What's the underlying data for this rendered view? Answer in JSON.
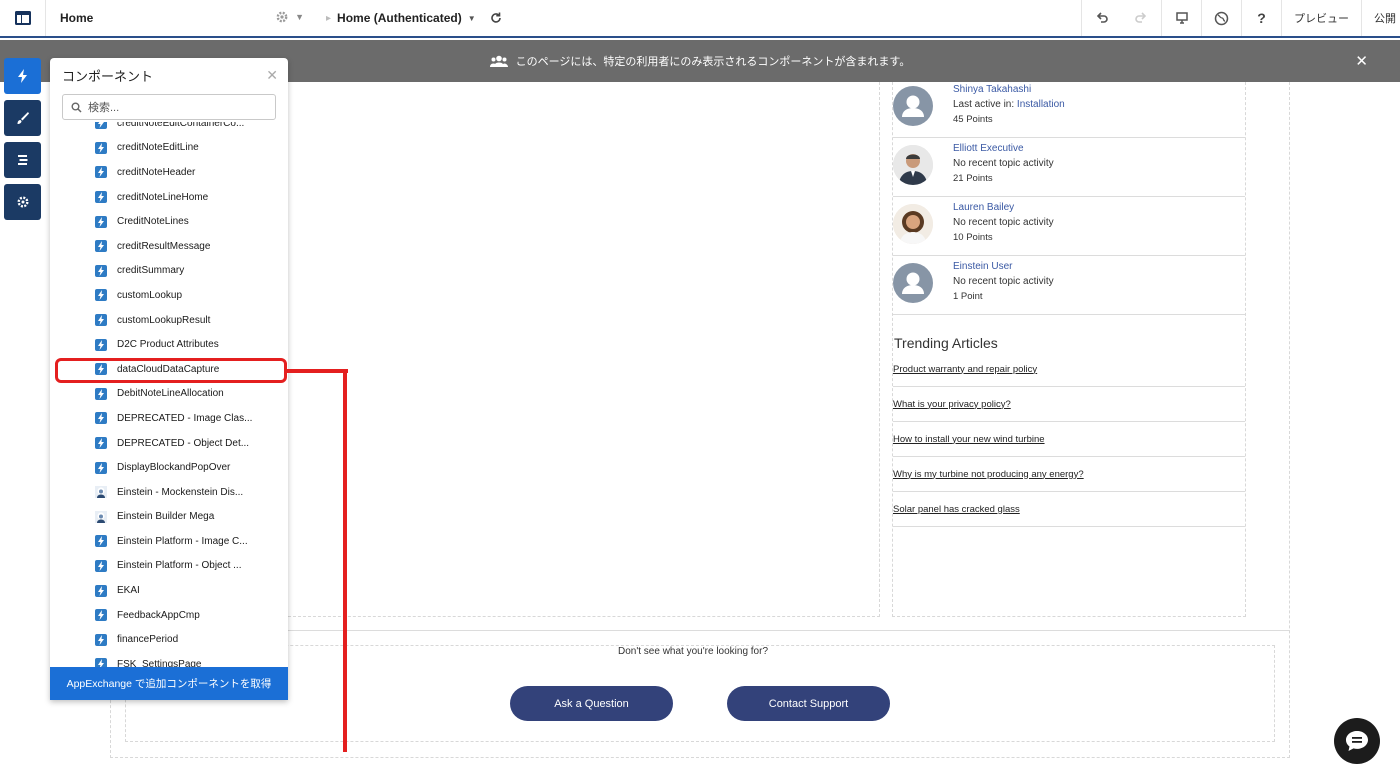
{
  "toolbar": {
    "site_label": "Home",
    "page_label": "Home (Authenticated)",
    "preview_label": "プレビュー",
    "publish_label": "公開"
  },
  "banner": {
    "message": "このページには、特定の利用者にのみ表示されるコンポーネントが含まれます。"
  },
  "panel": {
    "title": "コンポーネント",
    "search_placeholder": "検索...",
    "items": [
      {
        "label": "creditNoteEditContainerCo...",
        "icon": "lightning-icon"
      },
      {
        "label": "creditNoteEditLine",
        "icon": "lightning-icon"
      },
      {
        "label": "creditNoteHeader",
        "icon": "lightning-icon"
      },
      {
        "label": "creditNoteLineHome",
        "icon": "lightning-icon"
      },
      {
        "label": "CreditNoteLines",
        "icon": "lightning-icon"
      },
      {
        "label": "creditResultMessage",
        "icon": "lightning-icon"
      },
      {
        "label": "creditSummary",
        "icon": "lightning-icon"
      },
      {
        "label": "customLookup",
        "icon": "lightning-icon"
      },
      {
        "label": "customLookupResult",
        "icon": "lightning-icon"
      },
      {
        "label": "D2C Product Attributes",
        "icon": "lightning-icon"
      },
      {
        "label": "dataCloudDataCapture",
        "icon": "lightning-icon"
      },
      {
        "label": "DebitNoteLineAllocation",
        "icon": "lightning-icon"
      },
      {
        "label": "DEPRECATED - Image Clas...",
        "icon": "lightning-icon"
      },
      {
        "label": "DEPRECATED - Object Det...",
        "icon": "lightning-icon"
      },
      {
        "label": "DisplayBlockandPopOver",
        "icon": "lightning-icon"
      },
      {
        "label": "Einstein - Mockenstein Dis...",
        "icon": "einstein-icon"
      },
      {
        "label": "Einstein Builder Mega",
        "icon": "einstein-icon"
      },
      {
        "label": "Einstein Platform - Image C...",
        "icon": "lightning-icon"
      },
      {
        "label": "Einstein Platform - Object ...",
        "icon": "lightning-icon"
      },
      {
        "label": "EKAI",
        "icon": "lightning-icon"
      },
      {
        "label": "FeedbackAppCmp",
        "icon": "lightning-icon"
      },
      {
        "label": "financePeriod",
        "icon": "lightning-icon"
      },
      {
        "label": "FSK_SettingsPage",
        "icon": "lightning-icon"
      }
    ],
    "footer_label": "AppExchange で追加コンポーネントを取得"
  },
  "leaderboard": [
    {
      "name": "Shinya Takahashi",
      "activity_prefix": "Last active in: ",
      "activity_link": "Installation",
      "points": "45 Points",
      "avatar": "default-avatar"
    },
    {
      "name": "Elliott Executive",
      "activity_prefix": "No recent topic activity",
      "activity_link": "",
      "points": "21 Points",
      "avatar": "photo-avatar-man"
    },
    {
      "name": "Lauren Bailey",
      "activity_prefix": "No recent topic activity",
      "activity_link": "",
      "points": "10 Points",
      "avatar": "photo-avatar-woman"
    },
    {
      "name": "Einstein User",
      "activity_prefix": "No recent topic activity",
      "activity_link": "",
      "points": "1 Point",
      "avatar": "default-avatar"
    }
  ],
  "trending": {
    "title": "Trending Articles",
    "articles": [
      "Product warranty and repair policy",
      "What is your privacy policy?",
      "How to install your new wind turbine",
      "Why is my turbine not producing any energy?",
      "Solar panel has cracked glass"
    ]
  },
  "support": {
    "prompt": "Don't see what you're looking for?",
    "ask_label": "Ask a Question",
    "contact_label": "Contact Support"
  },
  "colors": {
    "toolbar_accent": "#2a4f8a",
    "panel_accent": "#1b6fd6",
    "rail_dark": "#1b3a64",
    "highlight": "#e41f1f",
    "button_navy": "#33427a"
  }
}
